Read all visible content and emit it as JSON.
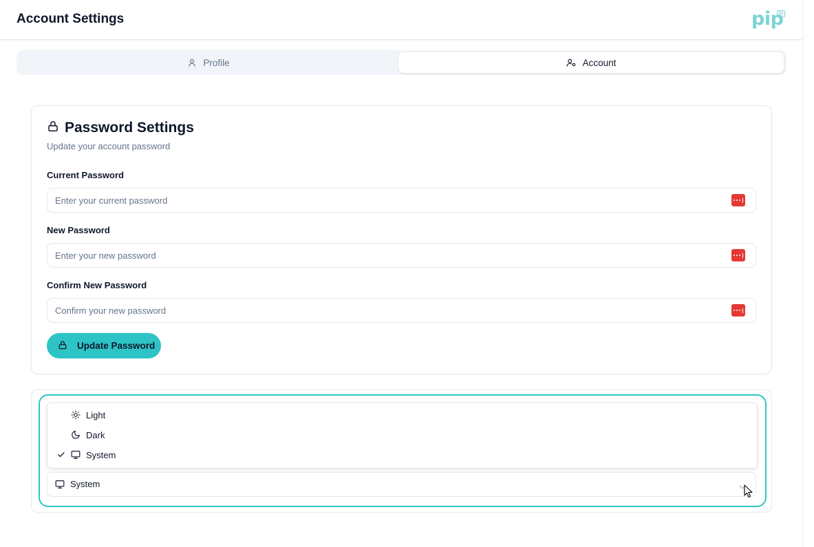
{
  "header": {
    "title": "Account Settings",
    "logo_text": "pip",
    "logo_badge": "IQ"
  },
  "tabs": [
    {
      "label": "Profile",
      "icon": "user-icon",
      "active": false
    },
    {
      "label": "Account",
      "icon": "user-cog-icon",
      "active": true
    }
  ],
  "password_card": {
    "title": "Password Settings",
    "title_icon": "lock-icon",
    "description": "Update your account password",
    "fields": [
      {
        "label": "Current Password",
        "placeholder": "Enter your current password",
        "value": ""
      },
      {
        "label": "New Password",
        "placeholder": "Enter your new password",
        "value": ""
      },
      {
        "label": "Confirm New Password",
        "placeholder": "Confirm your new password",
        "value": ""
      }
    ],
    "submit_label": "Update Password"
  },
  "theme": {
    "options": [
      {
        "label": "Light",
        "icon": "sun-icon",
        "selected": false
      },
      {
        "label": "Dark",
        "icon": "moon-icon",
        "selected": false
      },
      {
        "label": "System",
        "icon": "monitor-icon",
        "selected": true
      }
    ],
    "selected_label": "System",
    "selected_icon": "monitor-icon"
  },
  "colors": {
    "accent": "#2ec4c6",
    "logo": "#7dd3d6",
    "password_manager_icon": "#e53935",
    "muted_text": "#64748b"
  }
}
